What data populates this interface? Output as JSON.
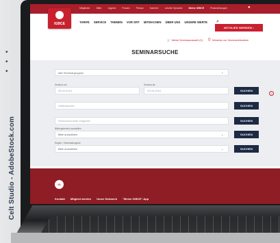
{
  "credit": "Celt Studio - AdobeStock.com",
  "header": {
    "logo_text": "IGBCE",
    "topnav": [
      "Mitglieder",
      "Mitte",
      "Jugend",
      "Frauen",
      "Presse",
      "Karriere",
      "Leichte Sprache",
      "Meine IGBCE",
      "Postmeldungen"
    ],
    "mainnav": [
      "TARIFE",
      "SERVICE",
      "THEMEN",
      "VOR ORT",
      "MITMACHEN",
      "ÜBER UNS",
      "UNSERE WERTE"
    ],
    "join_label": "MITGLIED WERDEN ›"
  },
  "sublinks": {
    "selection": "Meine Seminarauswahl (0)",
    "info": "Hinweise zur Seminarteilnahme"
  },
  "page_title": "SEMINARSUCHE",
  "form": {
    "group_select": "Alle Seminargruppen",
    "date_from_label": "Seminar von",
    "date_from": "06.05.2024",
    "date_to_label": "Seminar bis",
    "date_to": "09.05.2024",
    "fulltext_placeholder": "Volltextsuche",
    "number_placeholder": "Seminarnummer eingeben",
    "target_label": "Bildungsbereich auswählen",
    "target_select": "Bitte auswählen",
    "region_label": "Region / Veranstaltungsort",
    "region_select": "Bitte auswählen",
    "search_label": "SUCHEN"
  },
  "footer": {
    "circle": "IG",
    "links": [
      "Kontakt",
      "Mitglied werden",
      "Unser Netzwerk",
      "\"Meine IGBCE\"-App"
    ]
  }
}
